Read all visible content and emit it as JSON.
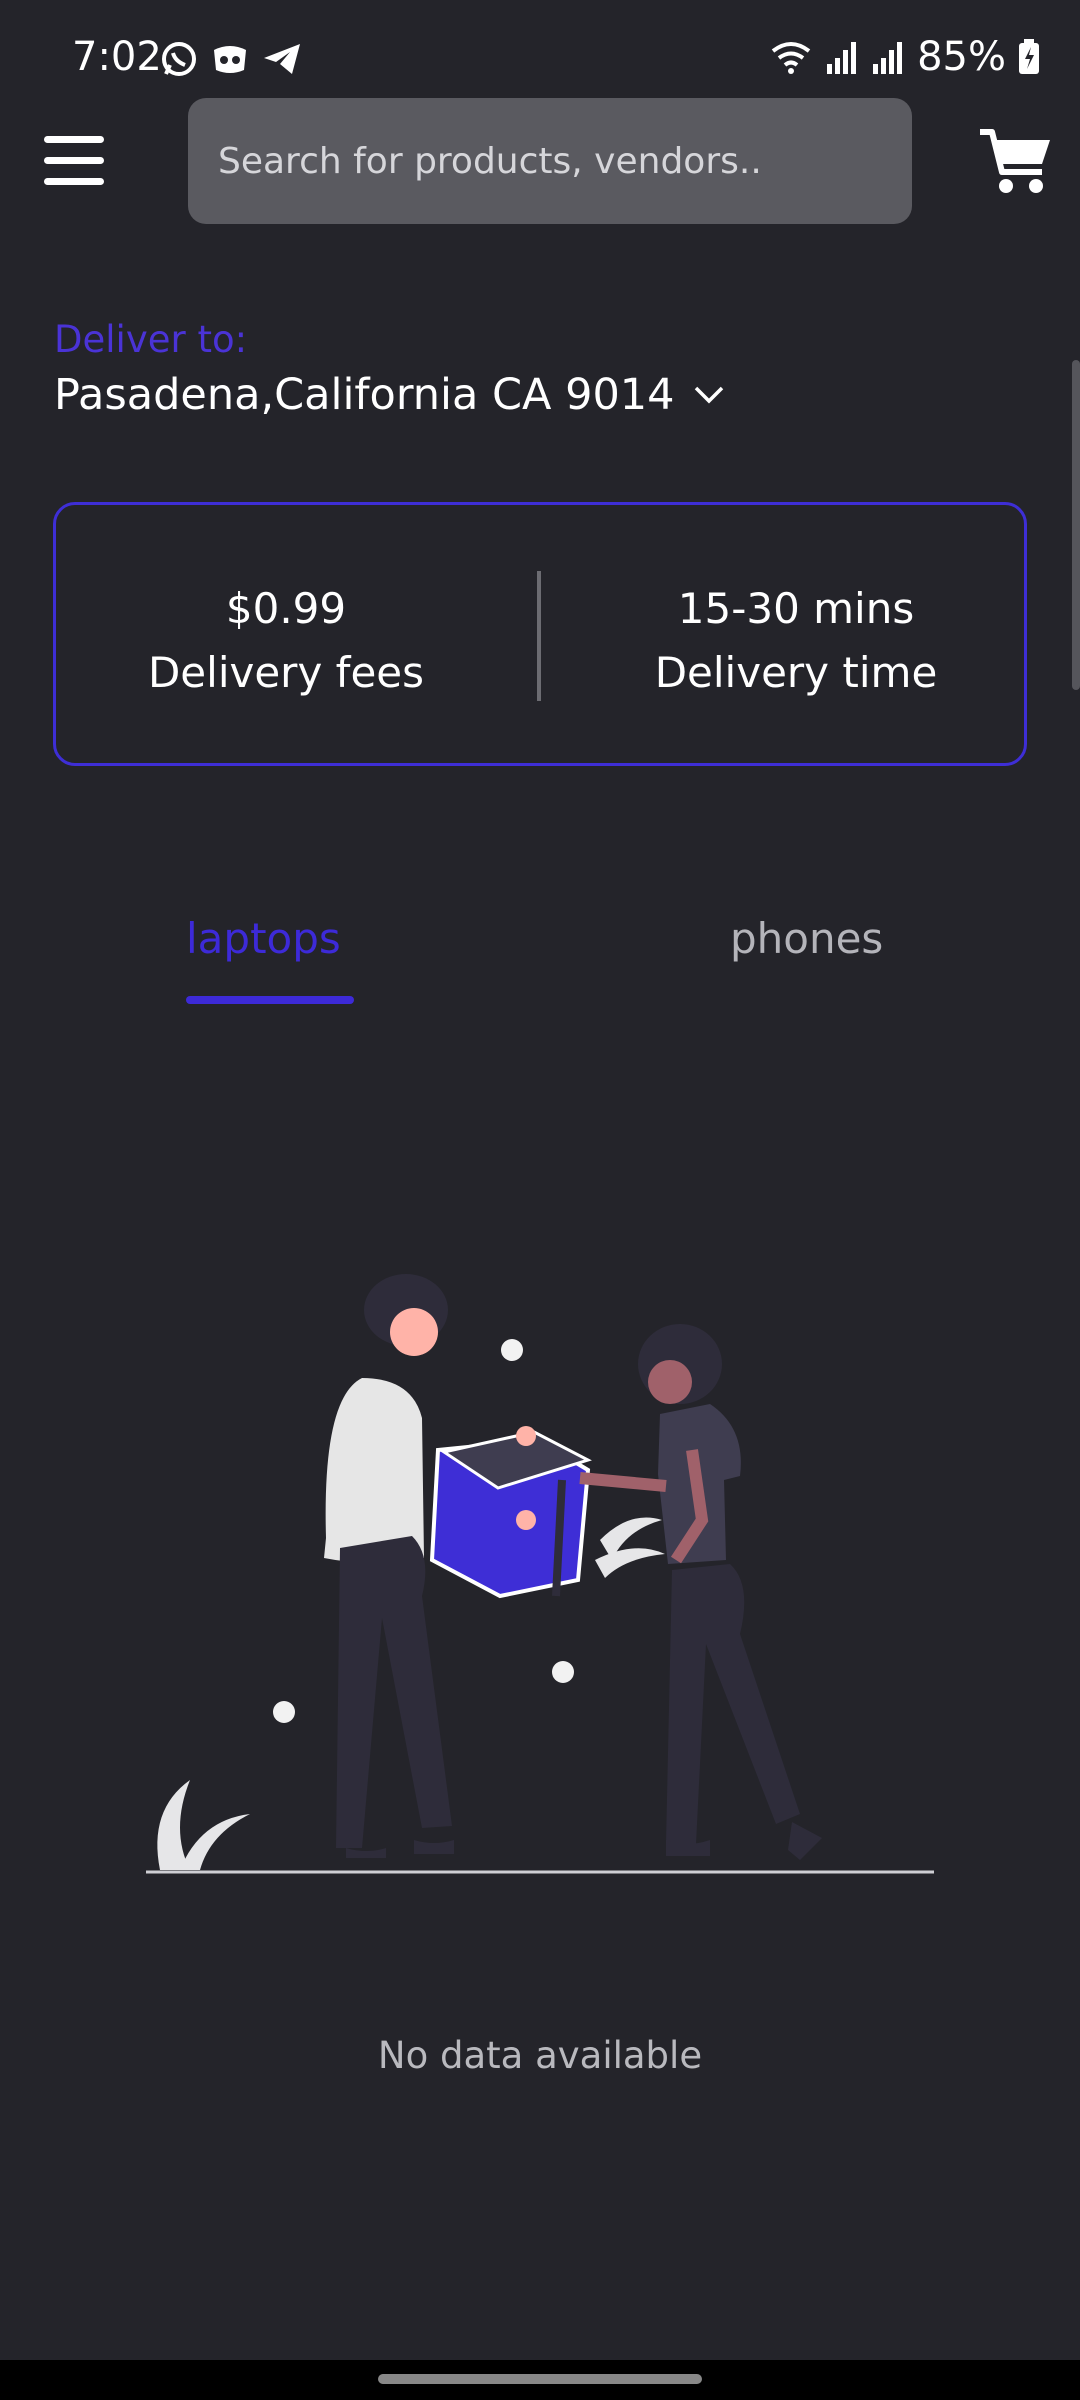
{
  "status_bar": {
    "time": "7:02",
    "battery": "85%",
    "app_icons": [
      "whatsapp-icon",
      "discord-icon",
      "telegram-icon"
    ]
  },
  "header": {
    "search_placeholder": "Search for products, vendors..",
    "menu_icon": "hamburger-menu-icon",
    "cart_icon": "cart-icon"
  },
  "delivery": {
    "label": "Deliver to:",
    "address": "Pasadena,California CA 9014",
    "fee_value": "$0.99",
    "fee_label": "Delivery fees",
    "time_value": "15-30 mins",
    "time_label": "Delivery time"
  },
  "tabs": [
    {
      "label": "laptops",
      "active": true
    },
    {
      "label": "phones",
      "active": false
    }
  ],
  "empty_state": {
    "message": "No data available"
  },
  "colors": {
    "background": "#24242a",
    "accent": "#3d2ad8",
    "search_bg": "#5a5a60"
  }
}
